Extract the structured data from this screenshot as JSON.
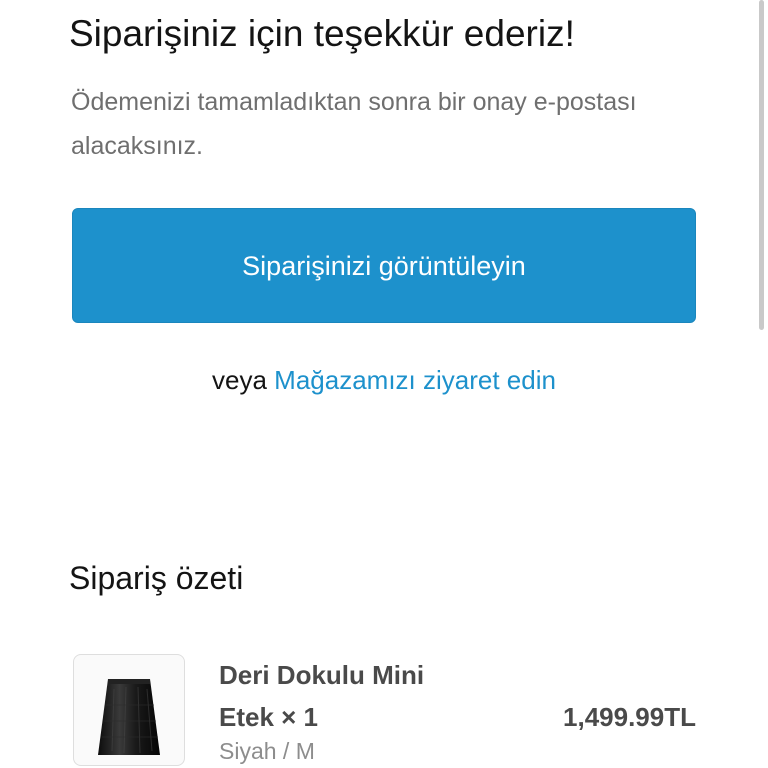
{
  "header": {
    "title": "Siparişiniz için teşekkür ederiz!",
    "subtitle": "Ödemenizi tamamladıktan sonra bir onay e-postası alacaksınız."
  },
  "actions": {
    "view_order_label": "Siparişinizi görüntüleyin",
    "or_text": "veya",
    "visit_store_label": "Mağazamızı ziyaret edin"
  },
  "order_summary": {
    "title": "Sipariş özeti",
    "items": [
      {
        "name": "Deri Dokulu Mini Etek × 1",
        "variant": "Siyah / M",
        "price": "1,499.99TL",
        "image_icon": "black-leather-mini-skirt-image"
      }
    ]
  },
  "colors": {
    "accent": "#1d91cc",
    "text_primary": "#141414",
    "text_secondary": "#6f6f6f"
  }
}
